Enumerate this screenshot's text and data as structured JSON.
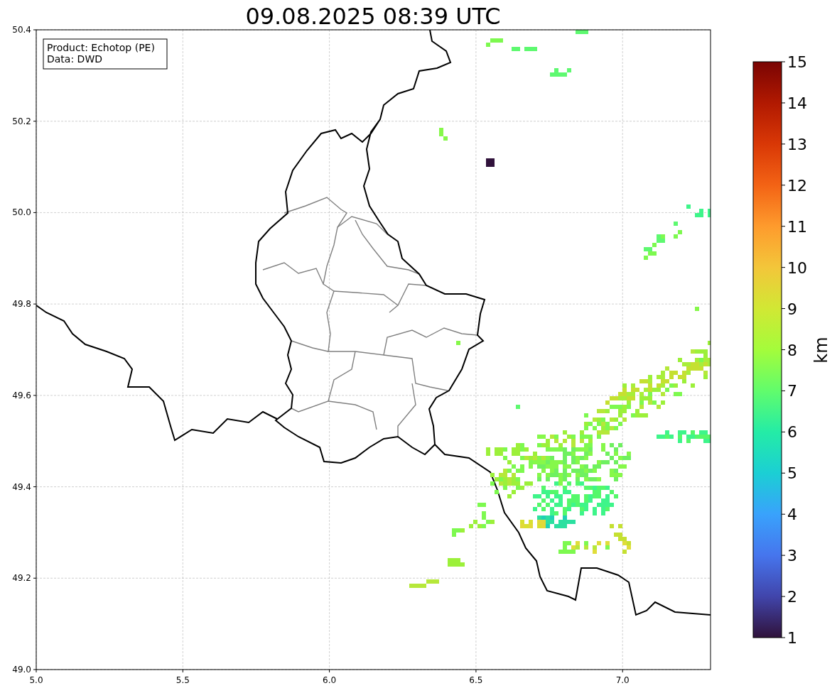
{
  "title": "09.08.2025 08:39 UTC",
  "info_box": [
    "Product: Echotop (PE)",
    "Data: DWD"
  ],
  "x_axis": {
    "ticks": [
      "5.0",
      "5.5",
      "6.0",
      "6.5",
      "7.0"
    ]
  },
  "y_axis": {
    "ticks": [
      "50.4",
      "50.2",
      "50.0",
      "49.8",
      "49.6",
      "49.4",
      "49.2",
      "49.0"
    ]
  },
  "colorbar": {
    "label": "km",
    "ticks": [
      "15",
      "14",
      "13",
      "12",
      "11",
      "10",
      "9",
      "8",
      "7",
      "6",
      "5",
      "4",
      "3",
      "2",
      "1"
    ]
  }
}
